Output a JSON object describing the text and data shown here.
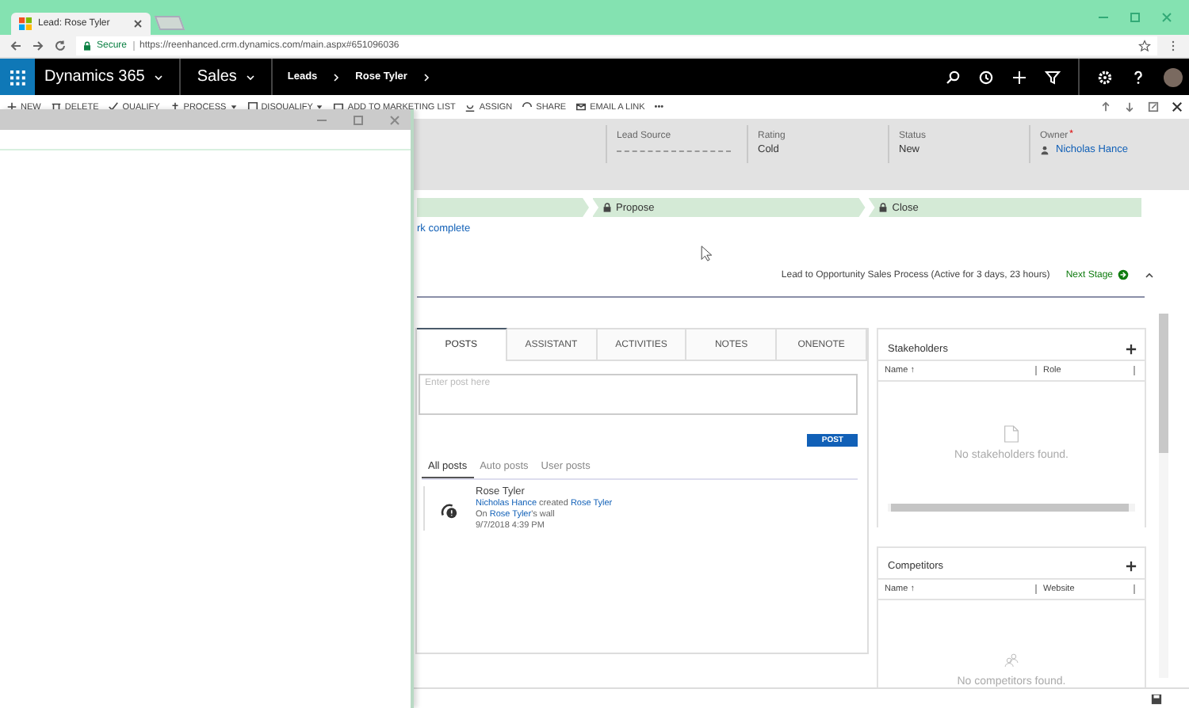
{
  "browser": {
    "tab_title": "Lead: Rose Tyler",
    "secure_label": "Secure",
    "url": "https://reenhanced.crm.dynamics.com/main.aspx#651096036"
  },
  "nav": {
    "app": "Dynamics 365",
    "area": "Sales",
    "breadcrumb": [
      "Leads",
      "Rose Tyler"
    ]
  },
  "commands": [
    {
      "label": "NEW",
      "dropdown": false
    },
    {
      "label": "DELETE",
      "dropdown": false
    },
    {
      "label": "QUALIFY",
      "dropdown": false
    },
    {
      "label": "PROCESS",
      "dropdown": true
    },
    {
      "label": "DISQUALIFY",
      "dropdown": true
    },
    {
      "label": "ADD TO MARKETING LIST",
      "dropdown": false
    },
    {
      "label": "ASSIGN",
      "dropdown": false
    },
    {
      "label": "SHARE",
      "dropdown": false
    },
    {
      "label": "EMAIL A LINK",
      "dropdown": false
    }
  ],
  "more_commands": "•••",
  "header_fields": [
    {
      "label": "Lead Source",
      "kind": "empty"
    },
    {
      "label": "Rating",
      "value": "Cold",
      "kind": "text"
    },
    {
      "label": "Status",
      "value": "New",
      "kind": "text"
    },
    {
      "label": "Owner",
      "required_mark": "*",
      "value": "Nicholas Hance",
      "kind": "user"
    }
  ],
  "process": {
    "stages": [
      {
        "label": "Propose",
        "locked": true
      },
      {
        "label": "Close",
        "locked": true
      }
    ],
    "step_link": "rk complete",
    "summary": "Lead to Opportunity Sales Process (Active for 3 days, 23 hours)",
    "next_stage": "Next Stage"
  },
  "social": {
    "tabs": [
      {
        "label": "POSTS",
        "selected": true
      },
      {
        "label": "ASSISTANT",
        "selected": false
      },
      {
        "label": "ACTIVITIES",
        "selected": false
      },
      {
        "label": "NOTES",
        "selected": false
      },
      {
        "label": "ONENOTE",
        "selected": false
      }
    ],
    "post_placeholder": "Enter post here",
    "post_button": "POST",
    "filters": [
      {
        "label": "All posts",
        "selected": true
      },
      {
        "label": "Auto posts",
        "selected": false
      },
      {
        "label": "User posts",
        "selected": false
      }
    ],
    "posts": [
      {
        "author": "Rose Tyler",
        "actor": "Nicholas Hance",
        "action": "created",
        "target": "Rose Tyler",
        "wall_prefix": "On",
        "wall_name": "Rose Tyler",
        "wall_suffix": "'s wall",
        "time": "9/7/2018 4:39 PM"
      }
    ]
  },
  "subgrids": [
    {
      "title": "Stakeholders",
      "columns": [
        "Name ↑",
        "Role"
      ],
      "empty": "No stakeholders found.",
      "kind": "document"
    },
    {
      "title": "Competitors",
      "columns": [
        "Name ↑",
        "Website"
      ],
      "empty": "No competitors found.",
      "kind": "people"
    }
  ]
}
